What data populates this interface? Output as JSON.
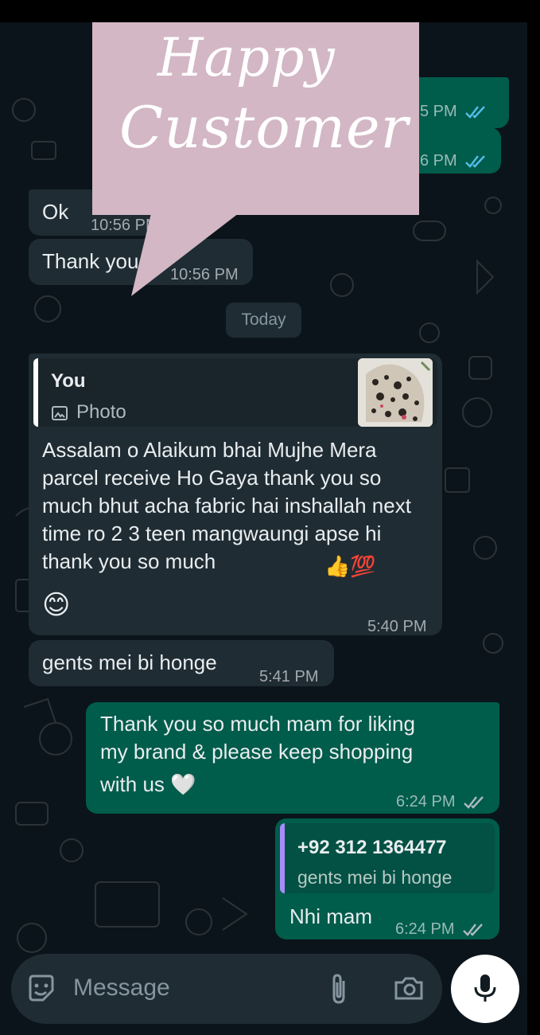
{
  "overlay": {
    "line1": "Happy",
    "line2": "Customer"
  },
  "messages": {
    "m1_time": "5 PM",
    "m2_time": "6 PM",
    "ok": {
      "text": "Ok",
      "time": "10:56 PM"
    },
    "thanks": {
      "text": "Thank you",
      "time": "10:56 PM"
    },
    "date_chip": "Today",
    "quoted_photo": {
      "sender": "You",
      "type_label": "Photo",
      "body": "Assalam o Alaikum bhai Mujhe Mera parcel receive Ho Gaya thank you so much bhut acha fabric hai inshallah next time ro  2 3 teen  mangwaungi apse hi thank you so much",
      "emoji_tail": "👍💯",
      "emoji_line": "😊",
      "time": "5:40 PM"
    },
    "gents": {
      "text": "gents mei bi honge",
      "time": "5:41 PM"
    },
    "reply1": {
      "line1": "Thank you so much mam for liking",
      "line2": "my brand & please keep shopping",
      "line3": "with us 🤍",
      "time": "6:24 PM"
    },
    "reply2": {
      "quote_sender": "+92 312 1364477",
      "quote_text": "gents mei bi honge",
      "text": "Nhi mam",
      "time": "6:24 PM"
    }
  },
  "composer": {
    "placeholder": "Message"
  },
  "icons": {
    "emoji": "sticker-smile-icon",
    "attach": "paperclip-icon",
    "camera": "camera-icon",
    "mic": "microphone-icon",
    "read_ticks": "double-check-icon"
  },
  "colors": {
    "background": "#0b141a",
    "incoming": "#1f2c34",
    "outgoing": "#005c4b",
    "ticks": "#53bdeb",
    "quote_bar_you": "#ffffff",
    "quote_bar_contact": "#a78bfa",
    "overlay": "#d3b7c4"
  }
}
